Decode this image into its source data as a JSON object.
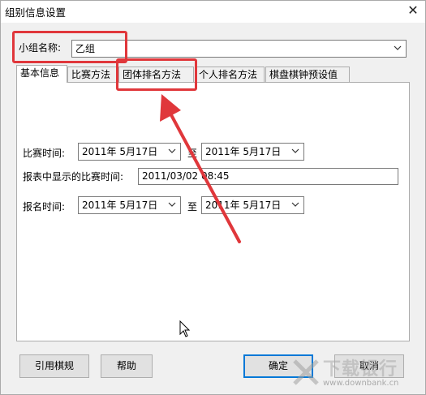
{
  "window": {
    "title": "组别信息设置",
    "close_glyph": "✕"
  },
  "group_name": {
    "label": "小组名称:",
    "value": "乙组"
  },
  "tabs": [
    {
      "label": "基本信息",
      "active": true
    },
    {
      "label": "比赛方法"
    },
    {
      "label": "团体排名方法"
    },
    {
      "label": "个人排名方法"
    },
    {
      "label": "棋盘棋钟预设值"
    }
  ],
  "basic": {
    "match_time_label": "比赛时间:",
    "match_start": "2011年 5月17日",
    "to_1": "至",
    "match_end": "2011年 5月17日",
    "report_time_label": "报表中显示的比赛时间:",
    "report_time_value": "2011/03/02  08:45",
    "signup_time_label": "报名时间:",
    "signup_start": "2011年 5月17日",
    "to_2": "至",
    "signup_end": "2011年 5月17日"
  },
  "buttons": {
    "reference": "引用棋规",
    "help": "帮助",
    "ok": "确定",
    "cancel": "取消"
  },
  "watermark": {
    "brand": "下载银行",
    "url": "www.downbank.cn"
  },
  "colors": {
    "annotation": "#e0373b",
    "focus": "#0078d7"
  }
}
